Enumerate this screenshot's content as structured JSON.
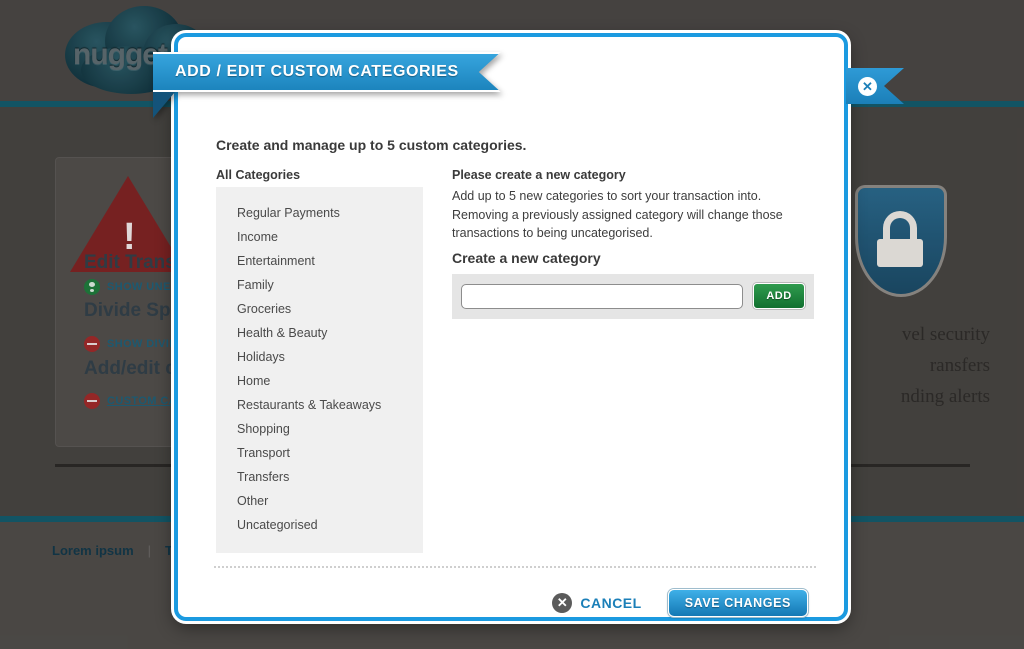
{
  "background": {
    "logo_text": "nugget",
    "card_headings": [
      "Edit Transa",
      "Divide Spli",
      "Add/edit c"
    ],
    "card_links": [
      {
        "icon": "person-icon",
        "label": "SHOW UNED"
      },
      {
        "icon": "minus-circle-icon",
        "label": "SHOW DIVID"
      },
      {
        "icon": "minus-circle-icon",
        "label": "CUSTOM CAT"
      }
    ],
    "warning_icon": "warning-triangle-icon",
    "security_icon": "shield-lock-icon",
    "features": [
      "vel security",
      "ransfers",
      "nding alerts"
    ],
    "footer_links": [
      "Lorem ipsum",
      "Te"
    ],
    "footer_separator": "|"
  },
  "modal": {
    "title": "ADD / EDIT CUSTOM CATEGORIES",
    "close_icon": "close-circle-icon",
    "intro": "Create and manage up to 5 custom categories.",
    "left": {
      "heading": "All Categories",
      "categories": [
        "Regular Payments",
        "Income",
        "Entertainment",
        "Family",
        "Groceries",
        "Health & Beauty",
        "Holidays",
        "Home",
        "Restaurants & Takeaways",
        "Shopping",
        "Transport",
        "Transfers",
        "Other",
        "Uncategorised"
      ]
    },
    "right": {
      "heading": "Please create a new category",
      "description": "Add up to 5 new categories to sort your transaction into. Removing a previously assigned category will change those transactions to being uncategorised.",
      "create_heading": "Create a new category",
      "input_value": "",
      "input_placeholder": "",
      "add_label": "ADD"
    },
    "footer": {
      "cancel_label": "CANCEL",
      "cancel_icon": "close-circle-icon",
      "save_label": "SAVE CHANGES"
    }
  },
  "colors": {
    "accent_blue": "#1b9ae0",
    "ribbon_blue": "#1c84bd",
    "add_green": "#11702f",
    "page_bg": "#474441",
    "teal_rule": "#145a6b",
    "list_bg": "#f0f0f0"
  }
}
